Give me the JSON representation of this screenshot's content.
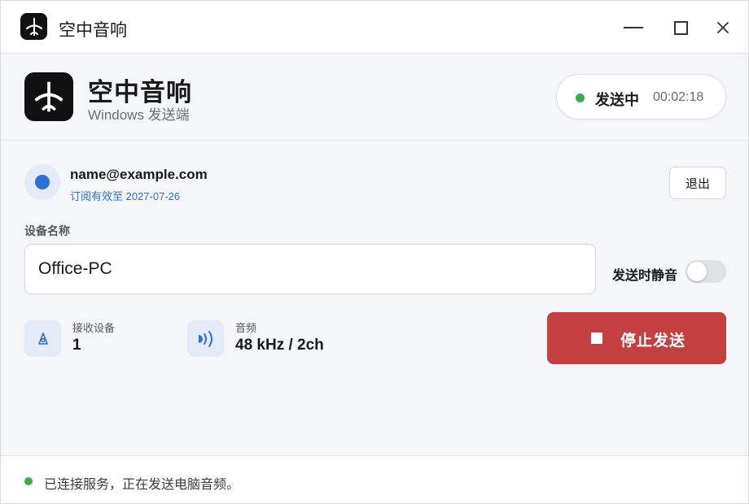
{
  "window": {
    "title": "空中音响",
    "controls": [
      "minimize-icon",
      "maximize-icon",
      "close-icon"
    ]
  },
  "header": {
    "app_name": "空中音响",
    "app_subtitle": "Windows 发送端",
    "logo_icon": "airplane-icon",
    "status": {
      "label": "发送中",
      "elapsed": "00:02:18",
      "dot_color": "#3dab4f"
    }
  },
  "account": {
    "email": "name@example.com",
    "subscription": "订阅有效至 2027-07-26",
    "logout_label": "退出",
    "avatar_color": "#2f6fd6"
  },
  "device": {
    "label": "设备名称",
    "name_value": "Office-PC",
    "mute_label": "发送时静音",
    "mute_enabled": false
  },
  "stats": {
    "receivers": {
      "label": "接收设备",
      "value": "1",
      "icon": "receiver-device-icon"
    },
    "audio": {
      "label": "音频",
      "value": "48 kHz / 2ch",
      "icon": "sound-wave-icon"
    }
  },
  "action": {
    "stop_label": "停止发送",
    "stop_icon": "stop-icon",
    "color": "#c43f3f"
  },
  "footer": {
    "message": "已连接服务，正在发送电脑音频。",
    "dot_color": "#3dab4f"
  }
}
